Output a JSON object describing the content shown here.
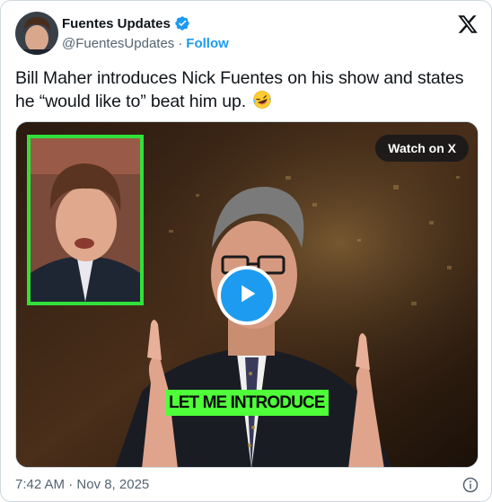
{
  "author": {
    "display_name": "Fuentes Updates",
    "handle": "@FuentesUpdates",
    "separator": "·",
    "follow_label": "Follow",
    "verified": true
  },
  "tweet": {
    "text_line1": "Bill Maher introduces Nick Fuentes on his show and states",
    "text_line2": "he “would like to” beat him up.",
    "emoji": "rolling-on-floor-laughing-emoji"
  },
  "media": {
    "watch_label": "Watch on X",
    "caption": "LET ME INTRODUCE",
    "caption_color": "#4fff3a",
    "inset_border_color": "#32e03a"
  },
  "footer": {
    "timestamp": "7:42 AM · Nov 8, 2025"
  },
  "colors": {
    "accent": "#1d9bf0",
    "text": "#0f1419",
    "muted": "#536471"
  }
}
